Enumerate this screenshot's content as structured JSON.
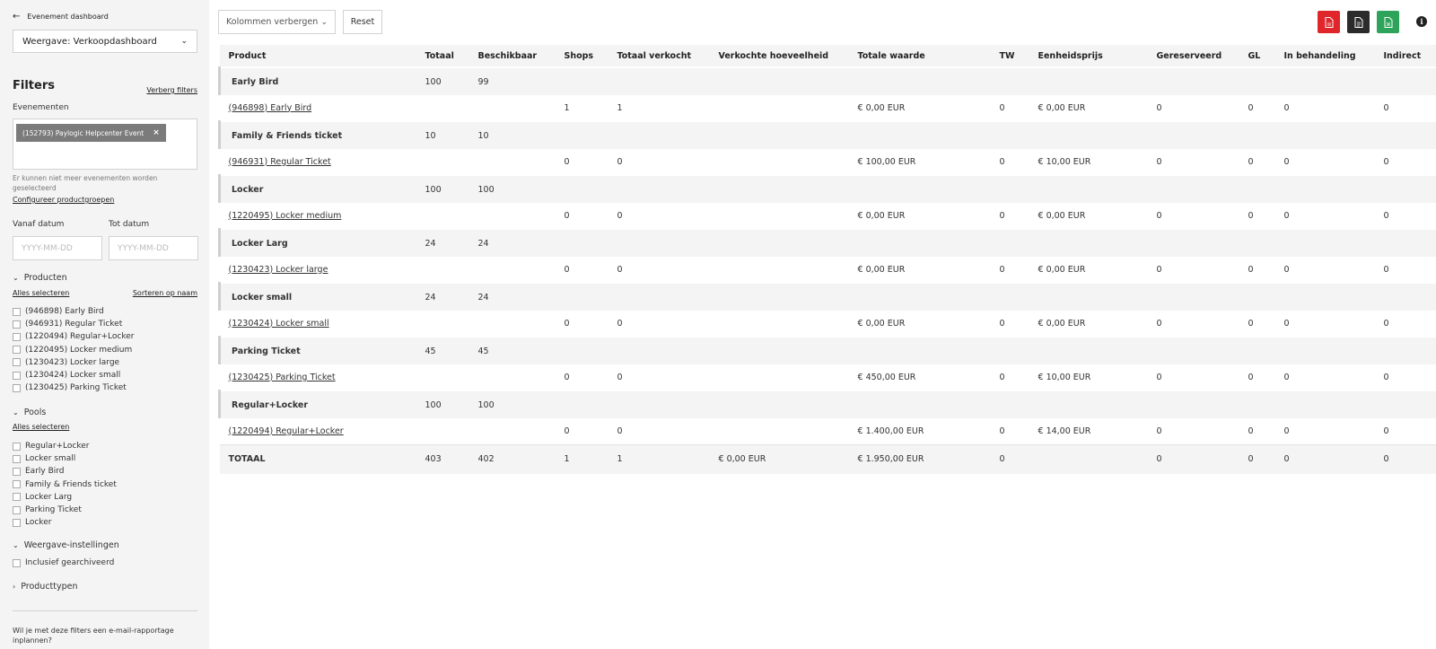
{
  "sidebar": {
    "back_label": "Evenement dashboard",
    "view_select": "Weergave:  Verkoopdashboard",
    "filters_title": "Filters",
    "hide_filters": "Verberg filters",
    "events_label": "Evenementen",
    "event_chip": "(152793) Paylogic Helpcenter Event",
    "events_hint": "Er kunnen niet meer evenementen worden geselecteerd",
    "configure_groups": "Configureer productgroepen",
    "from_date_label": "Vanaf datum",
    "to_date_label": "Tot datum",
    "from_date_placeholder": "YYYY-MM-DD",
    "to_date_placeholder": "YYYY-MM-DD",
    "products_section": "Producten",
    "select_all": "Alles selecteren",
    "sort_by_name": "Sorteren op naam",
    "products": [
      "(946898) Early Bird",
      "(946931) Regular Ticket",
      "(1220494) Regular+Locker",
      "(1220495) Locker medium",
      "(1230423) Locker large",
      "(1230424) Locker small",
      "(1230425) Parking Ticket"
    ],
    "pools_section": "Pools",
    "pools_select_all": "Alles selecteren",
    "pools": [
      "Regular+Locker",
      "Locker small",
      "Early Bird",
      "Family & Friends ticket",
      "Locker Larg",
      "Parking Ticket",
      "Locker"
    ],
    "view_settings_section": "Weergave-instellingen",
    "include_archived": "Inclusief gearchiveerd",
    "product_types_section": "Producttypen",
    "schedule_text": "Wil je met deze filters een e-mail-rapportage inplannen?"
  },
  "toolbar": {
    "hide_columns": "Kolommen verbergen",
    "reset": "Reset",
    "export_pdf_color": "#e0262b",
    "export_doc_color": "#2b2b2b",
    "export_xls_color": "#2ea35a"
  },
  "table": {
    "headers": [
      "Product",
      "Totaal",
      "Beschikbaar",
      "Shops",
      "Totaal verkocht",
      "Verkochte hoeveelheid",
      "Totale waarde",
      "TW",
      "Eenheidsprijs",
      "Gereserveerd",
      "GL",
      "In behandeling",
      "Indirect"
    ],
    "groups": [
      {
        "name": "Early Bird",
        "totaal": "100",
        "beschikbaar": "99",
        "item": {
          "name": "(946898) Early Bird",
          "shops": "1",
          "verkocht": "1",
          "waarde": "€ 0,00 EUR",
          "tw": "0",
          "prijs": "€ 0,00 EUR",
          "gereserveerd": "0",
          "gl": "0",
          "behandeling": "0",
          "indirect": "0"
        }
      },
      {
        "name": "Family & Friends ticket",
        "totaal": "10",
        "beschikbaar": "10",
        "item": {
          "name": "(946931) Regular Ticket",
          "shops": "0",
          "verkocht": "0",
          "waarde": "€ 100,00 EUR",
          "tw": "0",
          "prijs": "€ 10,00 EUR",
          "gereserveerd": "0",
          "gl": "0",
          "behandeling": "0",
          "indirect": "0"
        }
      },
      {
        "name": "Locker",
        "totaal": "100",
        "beschikbaar": "100",
        "item": {
          "name": "(1220495) Locker medium",
          "shops": "0",
          "verkocht": "0",
          "waarde": "€ 0,00 EUR",
          "tw": "0",
          "prijs": "€ 0,00 EUR",
          "gereserveerd": "0",
          "gl": "0",
          "behandeling": "0",
          "indirect": "0"
        }
      },
      {
        "name": "Locker Larg",
        "totaal": "24",
        "beschikbaar": "24",
        "item": {
          "name": "(1230423) Locker large",
          "shops": "0",
          "verkocht": "0",
          "waarde": "€ 0,00 EUR",
          "tw": "0",
          "prijs": "€ 0,00 EUR",
          "gereserveerd": "0",
          "gl": "0",
          "behandeling": "0",
          "indirect": "0"
        }
      },
      {
        "name": "Locker small",
        "totaal": "24",
        "beschikbaar": "24",
        "item": {
          "name": "(1230424) Locker small",
          "shops": "0",
          "verkocht": "0",
          "waarde": "€ 0,00 EUR",
          "tw": "0",
          "prijs": "€ 0,00 EUR",
          "gereserveerd": "0",
          "gl": "0",
          "behandeling": "0",
          "indirect": "0"
        }
      },
      {
        "name": "Parking Ticket",
        "totaal": "45",
        "beschikbaar": "45",
        "item": {
          "name": "(1230425) Parking Ticket",
          "shops": "0",
          "verkocht": "0",
          "waarde": "€ 450,00 EUR",
          "tw": "0",
          "prijs": "€ 10,00 EUR",
          "gereserveerd": "0",
          "gl": "0",
          "behandeling": "0",
          "indirect": "0"
        }
      },
      {
        "name": "Regular+Locker",
        "totaal": "100",
        "beschikbaar": "100",
        "item": {
          "name": "(1220494) Regular+Locker",
          "shops": "0",
          "verkocht": "0",
          "waarde": "€ 1.400,00 EUR",
          "tw": "0",
          "prijs": "€ 14,00 EUR",
          "gereserveerd": "0",
          "gl": "0",
          "behandeling": "0",
          "indirect": "0"
        }
      }
    ],
    "total": {
      "label": "TOTAAL",
      "totaal": "403",
      "beschikbaar": "402",
      "shops": "1",
      "verkocht": "1",
      "hoeveelheid": "€ 0,00 EUR",
      "waarde": "€ 1.950,00 EUR",
      "tw": "0",
      "prijs": "",
      "gereserveerd": "0",
      "gl": "0",
      "behandeling": "0",
      "indirect": "0"
    }
  }
}
